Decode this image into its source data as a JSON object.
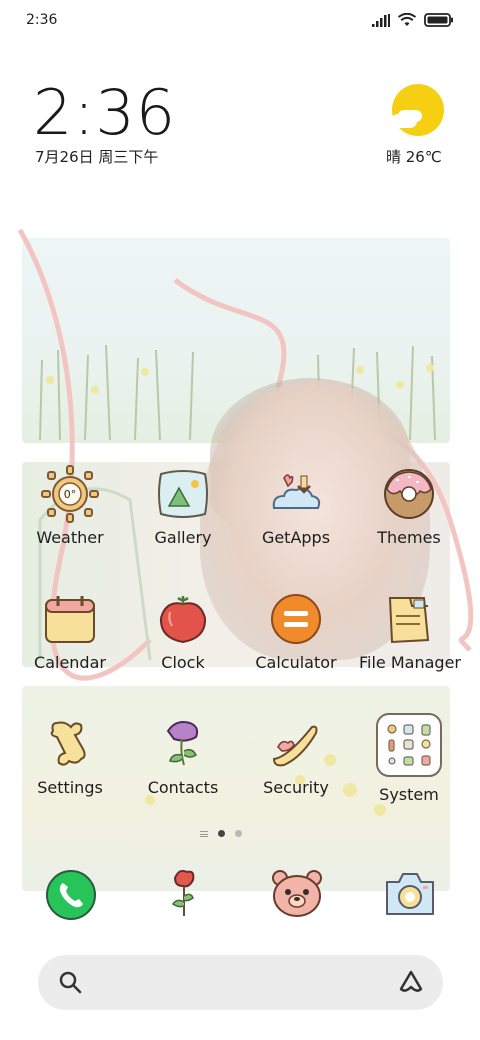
{
  "status_bar": {
    "time": "2:36",
    "icons": [
      "signal-icon",
      "wifi-icon",
      "battery-icon"
    ]
  },
  "clock_widget": {
    "time": "2:36",
    "date": "7月26日 周三下午"
  },
  "weather_widget": {
    "condition_icon": "sun-cloud-icon",
    "text": "晴 26℃"
  },
  "weather_icon_temp": "0°",
  "apps": [
    {
      "label": "Weather",
      "icon": "weather-icon"
    },
    {
      "label": "Gallery",
      "icon": "gallery-icon"
    },
    {
      "label": "GetApps",
      "icon": "getapps-icon"
    },
    {
      "label": "Themes",
      "icon": "themes-icon"
    },
    {
      "label": "Calendar",
      "icon": "calendar-icon"
    },
    {
      "label": "Clock",
      "icon": "clock-icon"
    },
    {
      "label": "Calculator",
      "icon": "calculator-icon"
    },
    {
      "label": "File Manager",
      "icon": "file-manager-icon"
    },
    {
      "label": "Settings",
      "icon": "settings-icon"
    },
    {
      "label": "Contacts",
      "icon": "contacts-icon"
    },
    {
      "label": "Security",
      "icon": "security-icon"
    },
    {
      "label": "System",
      "icon": "system-folder-icon"
    }
  ],
  "page_indicator": {
    "pages": 2,
    "current": 1
  },
  "dock": [
    {
      "icon": "phone-icon"
    },
    {
      "icon": "rose-icon"
    },
    {
      "icon": "bear-icon"
    },
    {
      "icon": "camera-icon"
    }
  ],
  "search_bar": {
    "icons": [
      "search-icon",
      "assistant-icon"
    ]
  },
  "colors": {
    "sun": "#f7cf12",
    "phone_green": "#27c45a",
    "calculator_orange": "#f08a2a",
    "search_bg": "#ececec"
  }
}
